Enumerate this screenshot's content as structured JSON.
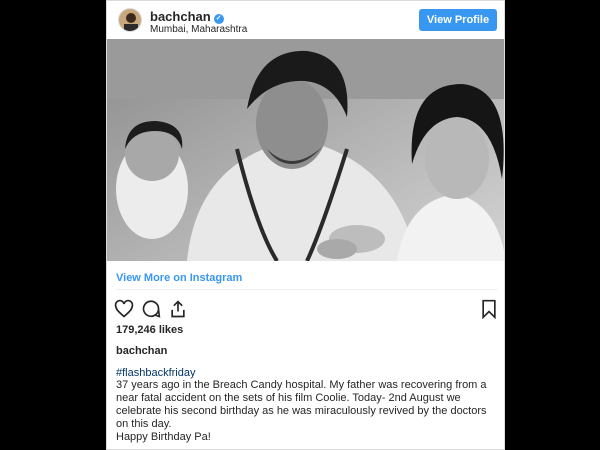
{
  "header": {
    "username": "bachchan",
    "location": "Mumbai, Maharashtra",
    "view_profile_label": "View Profile"
  },
  "photo": {
    "description": "black-and-white photo"
  },
  "view_more_label": "View More on Instagram",
  "actions": {
    "icons": [
      "heart-icon",
      "comment-icon",
      "share-icon",
      "bookmark-icon"
    ]
  },
  "likes": "179,246 likes",
  "caption": {
    "username": "bachchan",
    "hashtag": "#flashbackfriday",
    "text": "37 years ago in the Breach Candy hospital. My father was recovering from a near fatal accident on the sets of his film Coolie. Today- 2nd August we celebrate his second birthday as he was miraculously revived by the doctors on this day.",
    "closing": "Happy Birthday Pa!"
  },
  "colors": {
    "accent": "#3897f0",
    "hashtag": "#003569",
    "text": "#262626",
    "backdrop": "#000000"
  }
}
